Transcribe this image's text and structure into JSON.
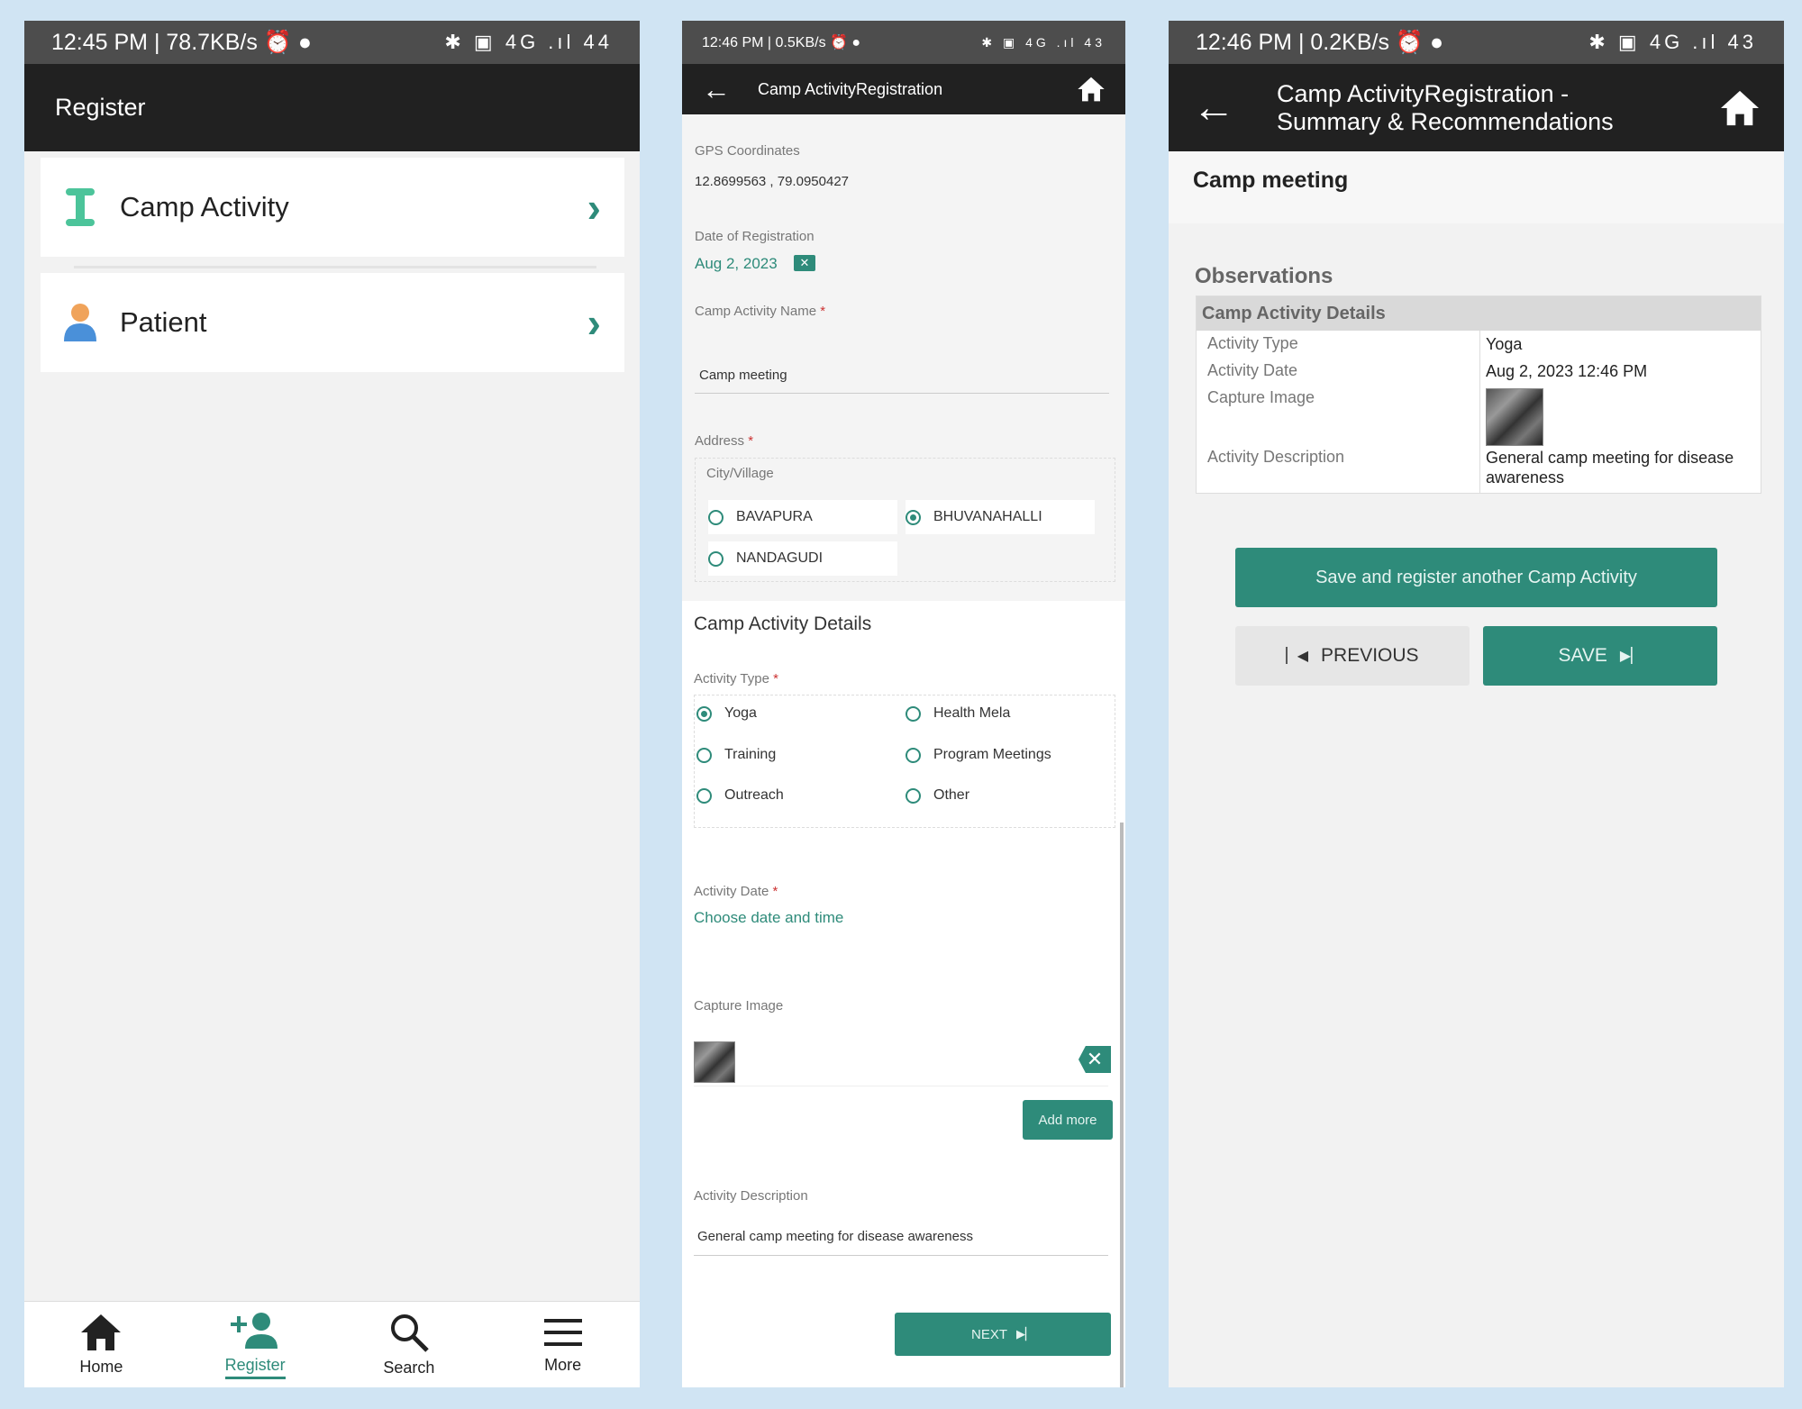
{
  "screen1": {
    "status": {
      "left": "12:45 PM | 78.7KB/s ⏰ ●",
      "right": "✱ ▣ 4G .ıl 44"
    },
    "title": "Register",
    "items": [
      {
        "label": "Camp Activity",
        "icon": "camp-activity-icon"
      },
      {
        "label": "Patient",
        "icon": "patient-icon"
      }
    ],
    "nav": [
      {
        "label": "Home",
        "icon": "home-icon"
      },
      {
        "label": "Register",
        "icon": "add-person-icon"
      },
      {
        "label": "Search",
        "icon": "search-icon"
      },
      {
        "label": "More",
        "icon": "menu-icon"
      }
    ]
  },
  "screen2": {
    "status": {
      "left": "12:46 PM | 0.5KB/s ⏰ ●",
      "right": "✱ ▣ 4G .ıl 43"
    },
    "title": "Camp ActivityRegistration",
    "gps_label": "GPS Coordinates",
    "gps_value": "12.8699563 , 79.0950427",
    "date_label": "Date of Registration",
    "date_value": "Aug 2, 2023",
    "name_label": "Camp Activity Name",
    "name_value": "Camp meeting",
    "address_label": "Address",
    "city_label": "City/Village",
    "cities": [
      "BAVAPURA",
      "BHUVANAHALLI",
      "NANDAGUDI"
    ],
    "selected_city": "BHUVANAHALLI",
    "section_title": "Camp Activity Details",
    "type_label": "Activity Type",
    "types": [
      "Yoga",
      "Health Mela",
      "Training",
      "Program Meetings",
      "Outreach",
      "Other"
    ],
    "selected_type": "Yoga",
    "adate_label": "Activity Date",
    "adate_placeholder": "Choose date and time",
    "capture_label": "Capture Image",
    "add_more": "Add more",
    "desc_label": "Activity Description",
    "desc_value": "General camp meeting for disease awareness",
    "next": "NEXT"
  },
  "screen3": {
    "status": {
      "left": "12:46 PM | 0.2KB/s ⏰ ●",
      "right": "✱ ▣ 4G .ıl 43"
    },
    "title_line1": "Camp ActivityRegistration -",
    "title_line2": "Summary & Recommendations",
    "heading": "Camp meeting",
    "observations": "Observations",
    "table_title": "Camp Activity Details",
    "rows": [
      {
        "key": "Activity Type",
        "value": "Yoga"
      },
      {
        "key": "Activity Date",
        "value": "Aug 2, 2023 12:46 PM"
      },
      {
        "key": "Capture Image",
        "value": ""
      },
      {
        "key": "Activity Description",
        "value": "General camp meeting for disease awareness"
      }
    ],
    "save_another": "Save and register another Camp Activity",
    "previous": "PREVIOUS",
    "save": "SAVE"
  },
  "colors": {
    "accent": "#2e8b7a",
    "appbar": "#212121",
    "statusbar": "#4d4d4d",
    "frame": "#d0e4f3"
  }
}
